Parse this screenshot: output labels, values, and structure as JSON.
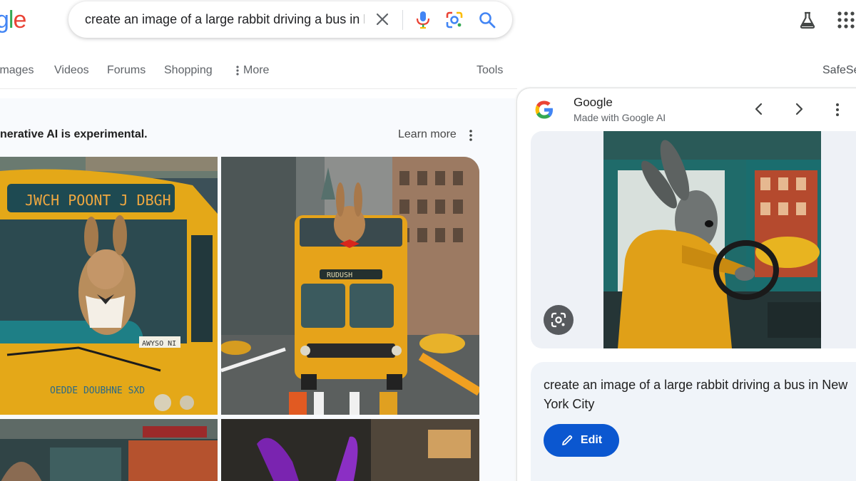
{
  "header": {
    "logo_parts": [
      "g",
      "l",
      "e"
    ],
    "search_query": "create an image of a large rabbit driving a bus in New York City",
    "icons": [
      "clear-icon",
      "mic-icon",
      "lens-icon",
      "search-icon",
      "labs-flask-icon",
      "apps-grid-icon"
    ]
  },
  "nav": {
    "tabs": [
      "Images",
      "Videos",
      "Forums",
      "Shopping"
    ],
    "more_label": "More",
    "tools_label": "Tools",
    "safesearch_label": "SafeSe"
  },
  "results": {
    "notice": "nerative AI is experimental.",
    "learn_more": "Learn more",
    "tiles": [
      {
        "sign": "JWCH POONT J DBGH",
        "plate": "AWYSO NI",
        "side": "OEDDE DOUBHNE SXD"
      },
      {
        "sign": "RUDUSH"
      },
      {},
      {}
    ]
  },
  "panel": {
    "source_title": "Google",
    "source_subtitle": "Made with Google AI",
    "prompt_text": "create an image of a large rabbit driving a bus in New York City",
    "edit_label": "Edit"
  },
  "colors": {
    "accent_blue": "#0b57d0",
    "bus_yellow": "#e8a317",
    "google_blue": "#4285f4",
    "google_red": "#ea4335",
    "google_yellow": "#fbbc05",
    "google_green": "#34a853"
  }
}
